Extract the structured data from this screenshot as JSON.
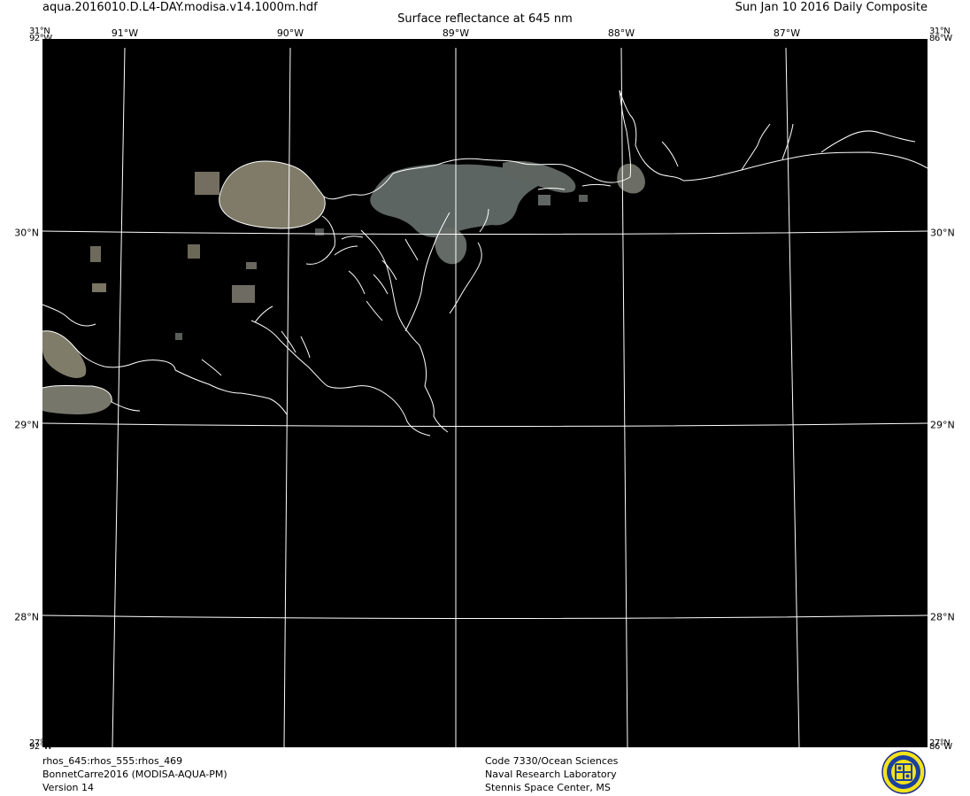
{
  "header": {
    "file_name": "aqua.2016010.D.L4-DAY.modisa.v14.1000m.hdf",
    "title": "Surface reflectance at 645 nm",
    "composite": "Sun Jan 10 2016 Daily Composite"
  },
  "graticule": {
    "longitudes": [
      "91°W",
      "90°W",
      "89°W",
      "88°W",
      "87°W"
    ],
    "latitudes": [
      "30°N",
      "29°N",
      "28°N"
    ],
    "corner_top": "31°N",
    "corner_left_top": "92°W",
    "corner_right_top": "86°W",
    "corner_bottom": "27°N",
    "corner_left_bottom": "92°W",
    "corner_right_bottom": "86°W"
  },
  "colors": {
    "ocean": "#000000",
    "grid": "#ffffff",
    "coast": "#ffffff",
    "turbid_water": "#7d7a68",
    "turbid_water_dark": "#5f6462"
  },
  "footer": {
    "left": [
      "rhos_645:rhos_555:rhos_469",
      "BonnetCarre2016 (MODISA-AQUA-PM)",
      "Version 14"
    ],
    "center": [
      "Code 7330/Ocean Sciences",
      "Naval Research Laboratory",
      "Stennis Space Center, MS"
    ]
  },
  "logo": {
    "icon": "navy-research-seal-icon"
  }
}
